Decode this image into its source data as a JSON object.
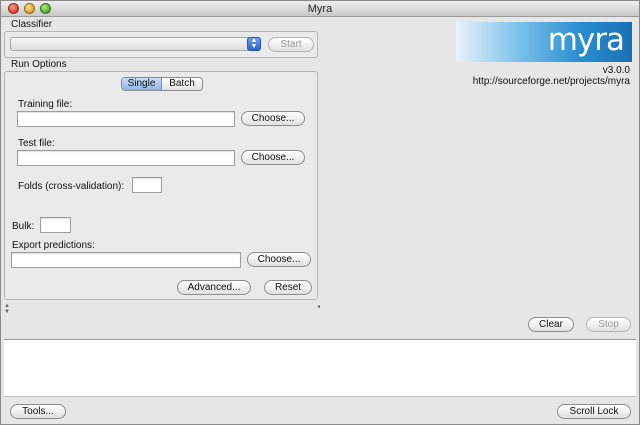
{
  "window": {
    "title": "Myra"
  },
  "classifier": {
    "label": "Classifier",
    "selected": "",
    "start_label": "Start"
  },
  "run_options": {
    "label": "Run Options",
    "modes": [
      "Single",
      "Batch"
    ],
    "active_mode": "Single",
    "training_label": "Training file:",
    "training_value": "",
    "test_label": "Test file:",
    "test_value": "",
    "choose_label": "Choose...",
    "folds_label": "Folds (cross-validation):",
    "folds_value": ""
  },
  "bulk": {
    "label": "Bulk:",
    "value": ""
  },
  "export": {
    "label": "Export predictions:",
    "value": "",
    "choose_label": "Choose..."
  },
  "actions": {
    "advanced_label": "Advanced...",
    "reset_label": "Reset"
  },
  "logo": {
    "text": "myra",
    "version": "v3.0.0",
    "url": "http://sourceforge.net/projects/myra"
  },
  "log_controls": {
    "clear_label": "Clear",
    "stop_label": "Stop"
  },
  "footer": {
    "tools_label": "Tools...",
    "scroll_lock_label": "Scroll Lock"
  },
  "colors": {
    "accent": "#2a63c9",
    "logo": "#2a8fd0"
  }
}
